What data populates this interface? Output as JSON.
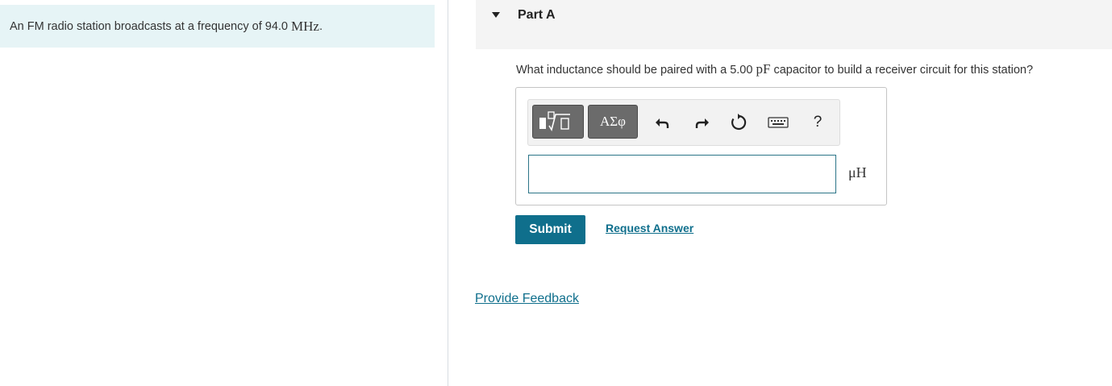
{
  "problem": {
    "statement_prefix": "An FM radio station broadcasts at a frequency of ",
    "frequency_value": "94.0",
    "frequency_unit": "MHz",
    "statement_suffix": " ."
  },
  "part": {
    "title": "Part A",
    "question_prefix": "What inductance should be paired with a ",
    "capacitance_value": "5.00",
    "capacitance_unit": "pF",
    "question_suffix": " capacitor to build a receiver circuit for this station?"
  },
  "toolbar": {
    "greek_label": "ΑΣφ",
    "help_label": "?",
    "icons": [
      "templates-icon",
      "greek-symbols-icon",
      "undo-icon",
      "redo-icon",
      "reset-icon",
      "keyboard-icon",
      "help-icon"
    ]
  },
  "answer": {
    "value": "",
    "placeholder": "",
    "unit": "μH"
  },
  "actions": {
    "submit_label": "Submit",
    "request_answer_label": "Request Answer",
    "feedback_label": "Provide Feedback"
  },
  "colors": {
    "accent": "#0f6f8c",
    "problem_background": "#e6f4f6",
    "header_background": "#f4f4f4"
  }
}
